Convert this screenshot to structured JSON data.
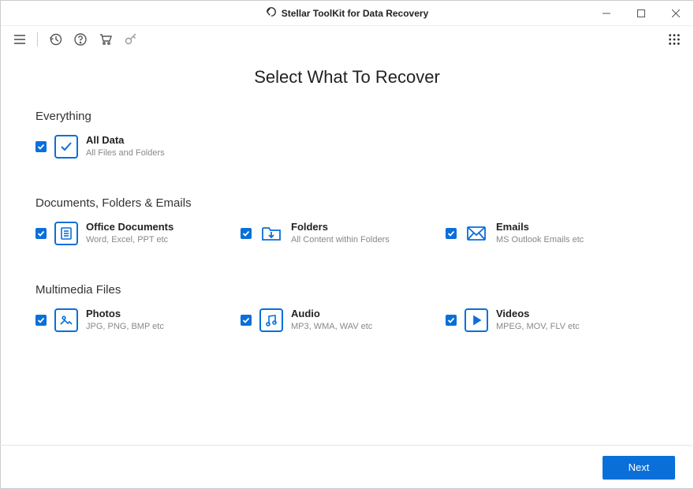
{
  "window": {
    "title": "Stellar ToolKit for Data Recovery"
  },
  "page": {
    "title": "Select What To Recover"
  },
  "sections": {
    "everything": {
      "header": "Everything",
      "all_data": {
        "title": "All Data",
        "sub": "All Files and Folders"
      }
    },
    "docs": {
      "header": "Documents, Folders & Emails",
      "office": {
        "title": "Office Documents",
        "sub": "Word, Excel, PPT etc"
      },
      "folders": {
        "title": "Folders",
        "sub": "All Content within Folders"
      },
      "emails": {
        "title": "Emails",
        "sub": "MS Outlook Emails etc"
      }
    },
    "media": {
      "header": "Multimedia Files",
      "photos": {
        "title": "Photos",
        "sub": "JPG, PNG, BMP etc"
      },
      "audio": {
        "title": "Audio",
        "sub": "MP3, WMA, WAV etc"
      },
      "videos": {
        "title": "Videos",
        "sub": "MPEG, MOV, FLV etc"
      }
    }
  },
  "footer": {
    "next_label": "Next"
  }
}
